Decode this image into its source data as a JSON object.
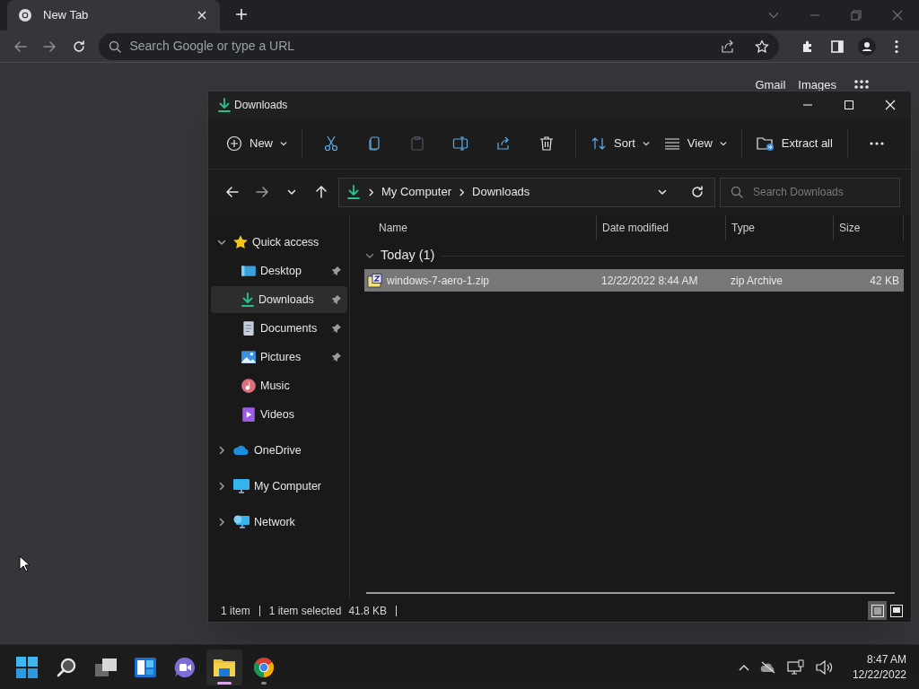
{
  "browser": {
    "tab": {
      "title": "New Tab",
      "selected": true
    },
    "omnibox": {
      "placeholder": "Search Google or type a URL"
    },
    "page_links": [
      "Gmail",
      "Images"
    ]
  },
  "explorer": {
    "title": "Downloads",
    "commands": [
      {
        "kind": "new",
        "label": "New",
        "disabled": false
      },
      {
        "kind": "cut",
        "disabled": false
      },
      {
        "kind": "copy",
        "disabled": false
      },
      {
        "kind": "paste",
        "disabled": true
      },
      {
        "kind": "rename",
        "disabled": false
      },
      {
        "kind": "share",
        "disabled": false
      },
      {
        "kind": "delete",
        "disabled": false
      },
      {
        "kind": "sort",
        "label": "Sort",
        "disabled": false
      },
      {
        "kind": "view",
        "label": "View",
        "disabled": false
      },
      {
        "kind": "extract",
        "label": "Extract all",
        "disabled": false
      },
      {
        "kind": "more",
        "disabled": false
      }
    ],
    "breadcrumb": [
      "My Computer",
      "Downloads"
    ],
    "search": {
      "placeholder": "Search Downloads"
    },
    "nav": [
      {
        "label": "Quick access",
        "kind": "star",
        "expanded": true,
        "selected": false,
        "children": [
          {
            "label": "Desktop",
            "kind": "desktop",
            "pinned": true,
            "selected": false
          },
          {
            "label": "Downloads",
            "kind": "download",
            "pinned": true,
            "selected": true
          },
          {
            "label": "Documents",
            "kind": "document",
            "pinned": true,
            "selected": false
          },
          {
            "label": "Pictures",
            "kind": "pictures",
            "pinned": true,
            "selected": false
          },
          {
            "label": "Music",
            "kind": "music",
            "pinned": false,
            "selected": false
          },
          {
            "label": "Videos",
            "kind": "videos",
            "pinned": false,
            "selected": false
          }
        ]
      },
      {
        "label": "OneDrive",
        "kind": "cloud",
        "expanded": false,
        "selected": false
      },
      {
        "label": "My Computer",
        "kind": "computer",
        "expanded": false,
        "selected": false
      },
      {
        "label": "Network",
        "kind": "network",
        "expanded": false,
        "selected": false
      }
    ],
    "columns": [
      "Name",
      "Date modified",
      "Type",
      "Size"
    ],
    "groups": [
      {
        "label": "Today (1)",
        "expanded": true,
        "rows": [
          {
            "cells": [
              "windows-7-aero-1.zip",
              "12/22/2022 8:44 AM",
              "zip Archive",
              "42 KB"
            ],
            "selected": true
          }
        ]
      }
    ],
    "status_bar": [
      [
        "1 item"
      ],
      [
        "1 item selected",
        "41.8 KB"
      ]
    ],
    "view_buttons": [
      {
        "kind": "details",
        "selected": true
      },
      {
        "kind": "tiles",
        "selected": false
      }
    ]
  },
  "taskbar": {
    "apps": [
      {
        "kind": "start",
        "active": false,
        "running": false
      },
      {
        "kind": "search",
        "active": false,
        "running": false
      },
      {
        "kind": "taskview",
        "active": false,
        "running": false
      },
      {
        "kind": "widgets",
        "active": false,
        "running": false
      },
      {
        "kind": "chat",
        "active": false,
        "running": false
      },
      {
        "kind": "explorer",
        "active": true,
        "running": true
      },
      {
        "kind": "chrome",
        "active": false,
        "running": true
      }
    ],
    "time": "8:47 AM",
    "date": "12/22/2022"
  }
}
